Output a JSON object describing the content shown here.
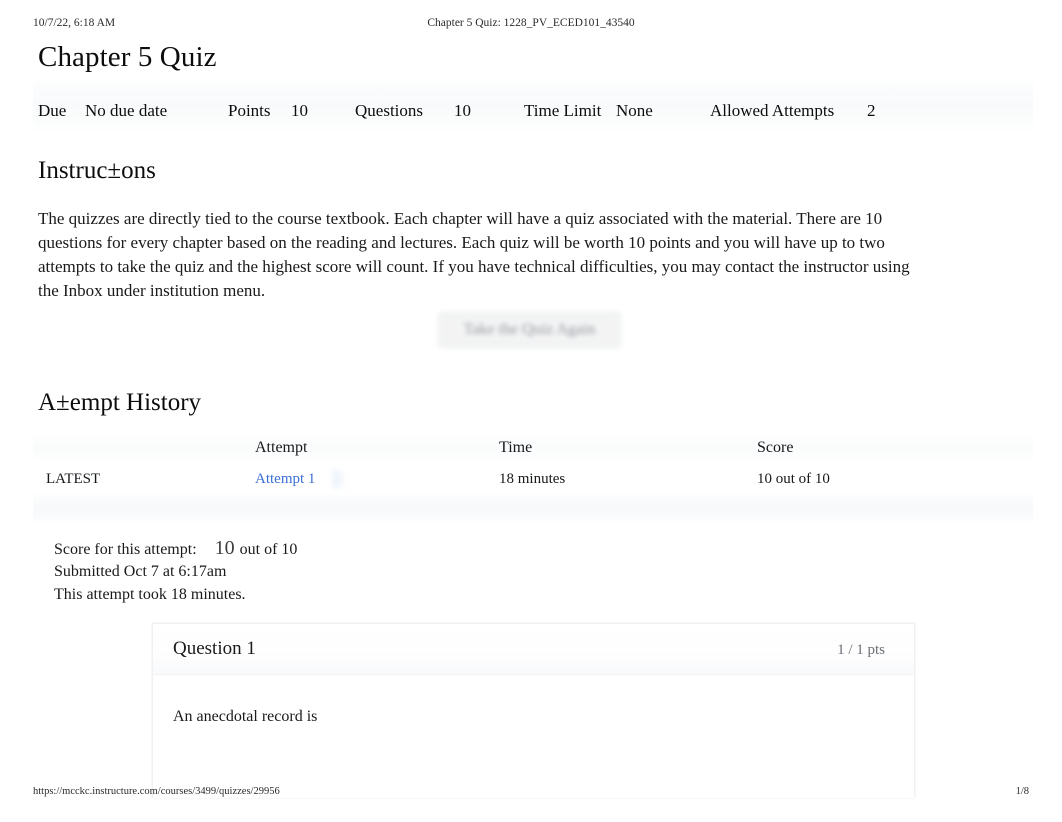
{
  "print": {
    "header_left": "10/7/22, 6:18 AM",
    "header_center": "Chapter 5 Quiz: 1228_PV_ECED101_43540",
    "footer_url": "https://mcckc.instructure.com/courses/3499/quizzes/29956",
    "footer_page": "1/8"
  },
  "quiz": {
    "title": "Chapter 5 Quiz",
    "meta": {
      "due_label": "Due",
      "due_value": "No due date",
      "points_label": "Points",
      "points_value": "10",
      "questions_label": "Questions",
      "questions_value": "10",
      "time_limit_label": "Time Limit",
      "time_limit_value": "None",
      "allowed_attempts_label": "Allowed Attempts",
      "allowed_attempts_value": "2"
    }
  },
  "instructions": {
    "heading": "Instruc±ons",
    "body": "The quizzes are directly tied to the course textbook. Each chapter will have a quiz associated with the material. There are 10 questions for every chapter based on the reading and lectures. Each quiz will be worth 10 points and you will have up to two attempts to take the quiz and the highest score will count. If you have technical difficulties, you may contact the instructor using the Inbox under institution menu."
  },
  "actions": {
    "retake_label": "Take the Quiz Again"
  },
  "attempt_history": {
    "heading": "A±empt History",
    "columns": [
      "",
      "Attempt",
      "Time",
      "Score"
    ],
    "rows": [
      {
        "kept": "LATEST",
        "attempt": "Attempt 1",
        "time": "18 minutes",
        "score": "10 out of 10"
      }
    ]
  },
  "attempt_summary": {
    "score_label": "Score for this attempt:",
    "score_value": "10",
    "score_suffix": "out of 10",
    "submitted": "Submitted Oct 7 at 6:17am",
    "duration": "This attempt took 18 minutes."
  },
  "questions": [
    {
      "title": "Question 1",
      "points": "1 / 1 pts",
      "text": "An anecdotal record is"
    }
  ],
  "colors": {
    "link": "#3c6fd4",
    "muted": "#6b7075",
    "text": "#1a1a1a"
  }
}
